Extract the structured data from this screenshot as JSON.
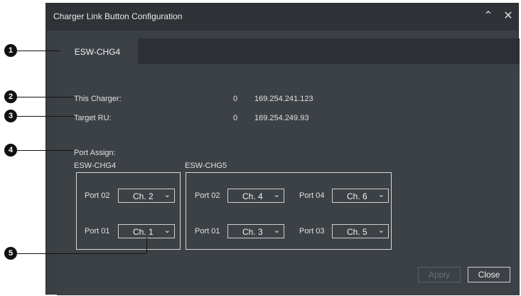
{
  "dialog": {
    "title": "Charger Link Button Configuration",
    "tab": "ESW-CHG4"
  },
  "info": {
    "this_charger_label": "This Charger:",
    "this_charger_num": "0",
    "this_charger_ip": "169.254.241.123",
    "target_ru_label": "Target RU:",
    "target_ru_num": "0",
    "target_ru_ip": "169.254.249.93",
    "port_assign_label": "Port Assign:"
  },
  "groups": {
    "chg4": {
      "title": "ESW-CHG4",
      "port02_label": "Port 02",
      "port02_val": "Ch. 2",
      "port01_label": "Port 01",
      "port01_val": "Ch. 1"
    },
    "chg5": {
      "title": "ESW-CHG5",
      "port02_label": "Port 02",
      "port02_val": "Ch. 4",
      "port04_label": "Port 04",
      "port04_val": "Ch. 6",
      "port01_label": "Port 01",
      "port01_val": "Ch. 3",
      "port03_label": "Port 03",
      "port03_val": "Ch. 5"
    }
  },
  "buttons": {
    "apply": "Apply",
    "close": "Close"
  },
  "callouts": [
    "1",
    "2",
    "3",
    "4",
    "5"
  ],
  "icons": {
    "collapse": "chevron-up-double-icon",
    "close": "close-icon",
    "dropdown": "chevron-down-icon"
  }
}
